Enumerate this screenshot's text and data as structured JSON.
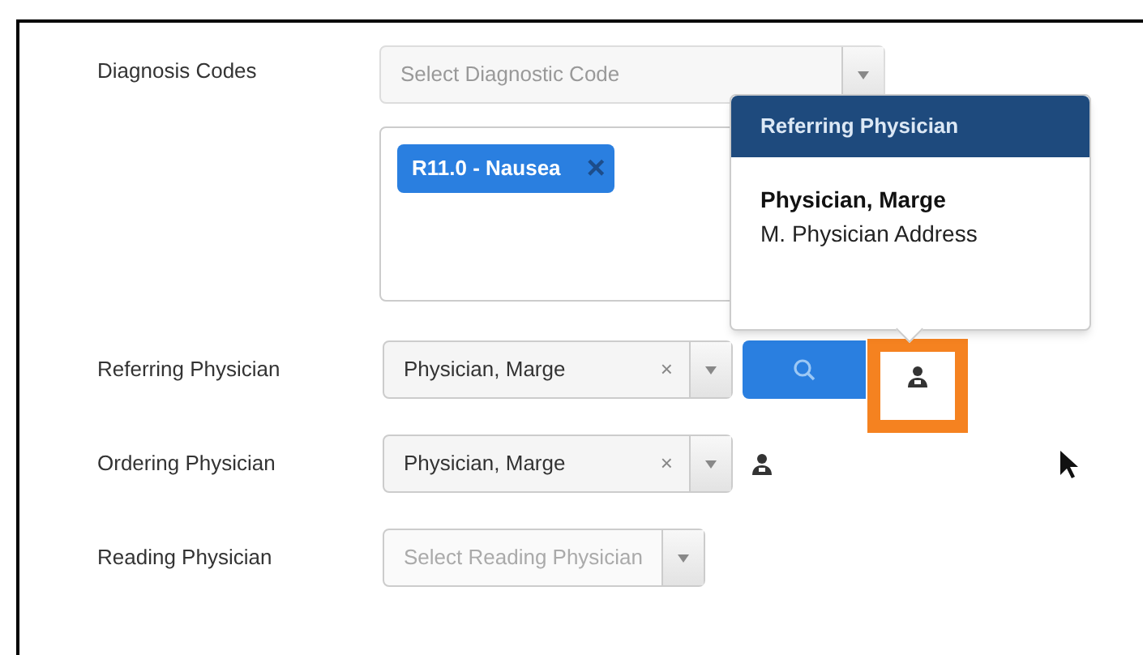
{
  "diagnosis_codes": {
    "label": "Diagnosis Codes",
    "placeholder": "Select Diagnostic Code",
    "tags": [
      {
        "label": "R11.0 - Nausea",
        "remove": "×"
      }
    ]
  },
  "physicians": [
    {
      "kind": "search",
      "label": "Referring Physician",
      "value": "Physician, Marge",
      "clear": "×",
      "highlighted": true
    },
    {
      "kind": "plain",
      "label": "Ordering Physician",
      "value": "Physician, Marge",
      "clear": "×",
      "highlighted": false
    },
    {
      "kind": "empty",
      "label": "Reading Physician",
      "placeholder": "Select Reading Physician"
    }
  ],
  "popover": {
    "title": "Referring Physician",
    "name": "Physician, Marge",
    "address": "M. Physician Address"
  }
}
